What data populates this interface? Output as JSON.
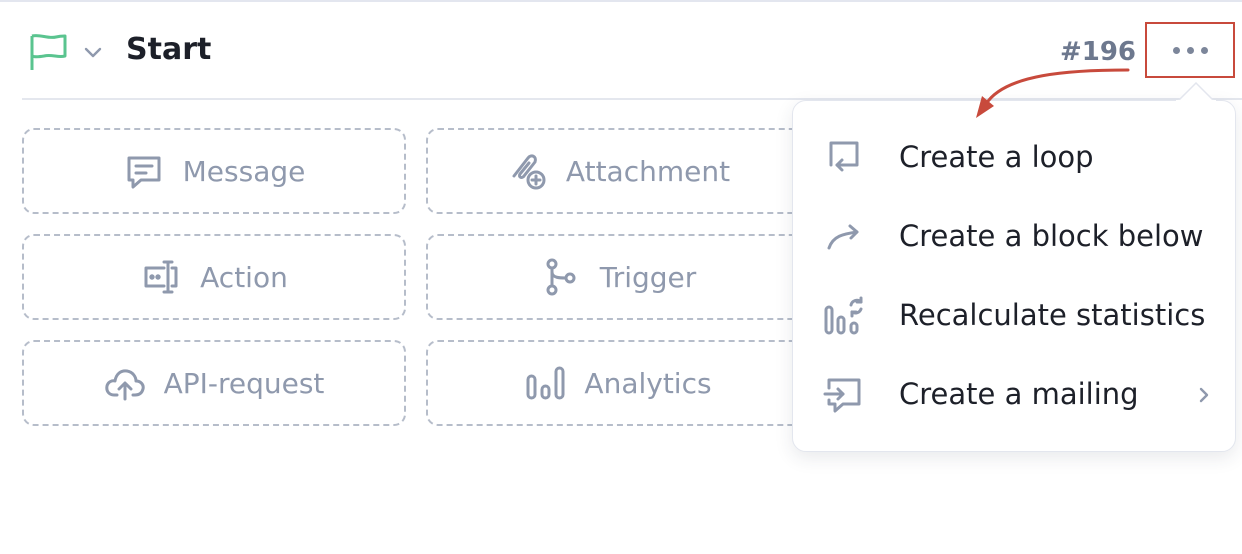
{
  "header": {
    "title": "Start",
    "block_id": "#196",
    "flag_icon": "flag-icon",
    "flag_color": "#5ac48f",
    "chevron_icon": "chevron-down-icon",
    "more_icon": "more-horizontal-icon"
  },
  "tiles": [
    {
      "label": "Message",
      "icon": "message-icon"
    },
    {
      "label": "Attachment",
      "icon": "attachment-icon"
    },
    {
      "label": "Action",
      "icon": "action-icon"
    },
    {
      "label": "Trigger",
      "icon": "trigger-icon"
    },
    {
      "label": "API-request",
      "icon": "cloud-upload-icon"
    },
    {
      "label": "Analytics",
      "icon": "analytics-icon"
    }
  ],
  "menu": {
    "items": [
      {
        "label": "Create a loop",
        "icon": "loop-icon"
      },
      {
        "label": "Create a block below",
        "icon": "arrow-curve-icon"
      },
      {
        "label": "Recalculate statistics",
        "icon": "recalculate-icon"
      },
      {
        "label": "Create a mailing",
        "icon": "mailing-icon",
        "submenu": true
      }
    ]
  },
  "colors": {
    "highlight": "#c84a3c",
    "muted": "#8f99ad",
    "text": "#1d2029"
  }
}
